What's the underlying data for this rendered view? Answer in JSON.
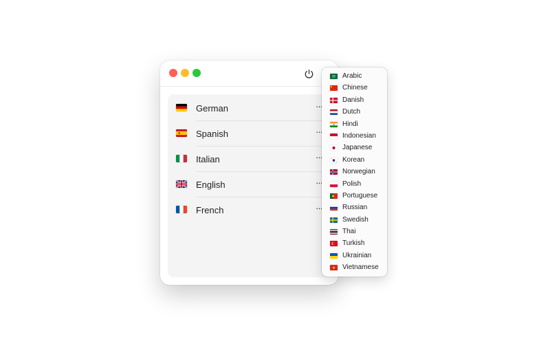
{
  "window": {
    "languages": [
      {
        "name": "German",
        "flag": "de-flag-icon",
        "more_label": "···"
      },
      {
        "name": "Spanish",
        "flag": "es-flag-icon",
        "more_label": "···"
      },
      {
        "name": "Italian",
        "flag": "it-flag-icon",
        "more_label": "···"
      },
      {
        "name": "English",
        "flag": "gb-flag-icon",
        "more_label": "···"
      },
      {
        "name": "French",
        "flag": "fr-flag-icon",
        "more_label": "···"
      }
    ]
  },
  "menu": {
    "items": [
      {
        "label": "Arabic",
        "flag": "sa-flag-icon"
      },
      {
        "label": "Chinese",
        "flag": "cn-flag-icon"
      },
      {
        "label": "Danish",
        "flag": "dk-flag-icon"
      },
      {
        "label": "Dutch",
        "flag": "nl-flag-icon"
      },
      {
        "label": "Hindi",
        "flag": "in-flag-icon"
      },
      {
        "label": "Indonesian",
        "flag": "id-flag-icon"
      },
      {
        "label": "Japanese",
        "flag": "jp-flag-icon"
      },
      {
        "label": "Korean",
        "flag": "kr-flag-icon"
      },
      {
        "label": "Norwegian",
        "flag": "no-flag-icon"
      },
      {
        "label": "Polish",
        "flag": "pl-flag-icon"
      },
      {
        "label": "Portuguese",
        "flag": "pt-flag-icon"
      },
      {
        "label": "Russian",
        "flag": "ru-flag-icon"
      },
      {
        "label": "Swedish",
        "flag": "se-flag-icon"
      },
      {
        "label": "Thai",
        "flag": "th-flag-icon"
      },
      {
        "label": "Turkish",
        "flag": "tr-flag-icon"
      },
      {
        "label": "Ukrainian",
        "flag": "ua-flag-icon"
      },
      {
        "label": "Vietnamese",
        "flag": "vn-flag-icon"
      }
    ]
  },
  "colors": {
    "close": "#fe5f57",
    "minimize": "#febc2e",
    "maximize": "#28c840",
    "panel": "#f4f4f5"
  }
}
